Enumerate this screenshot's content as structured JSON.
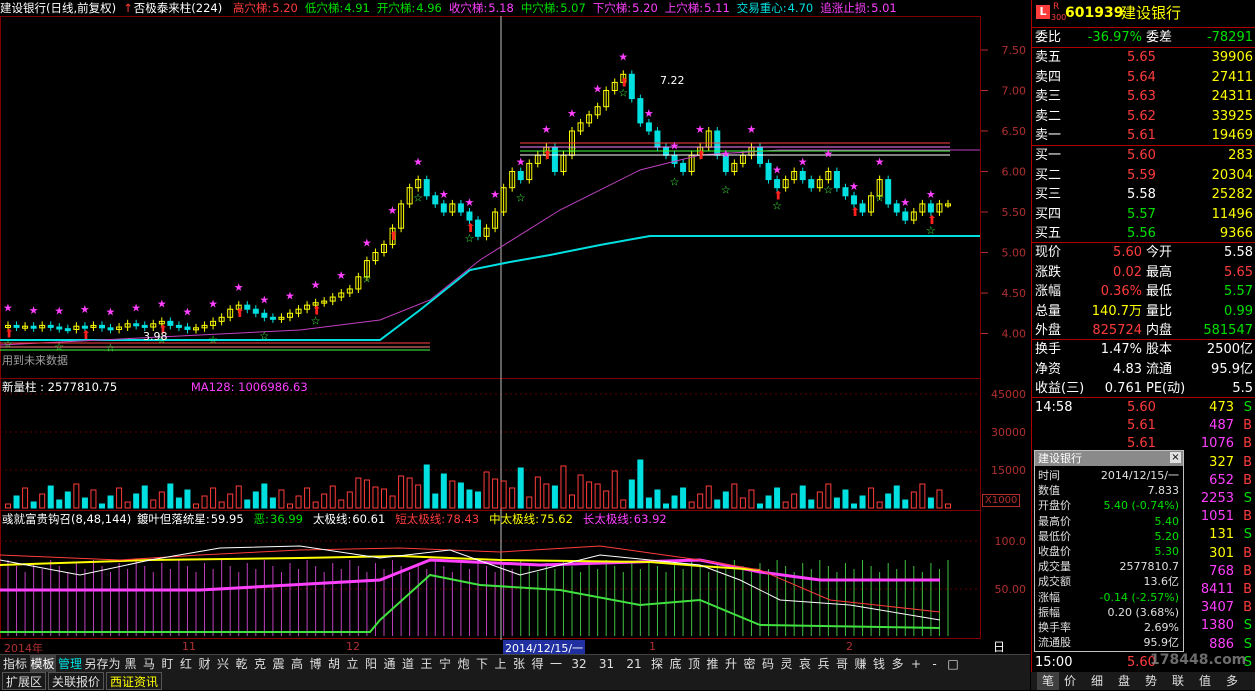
{
  "main_header": {
    "title": "建设银行(日线,前复权)",
    "indicator": "否极泰来柱(224)",
    "items": [
      {
        "label": "高穴梯:",
        "value": "5.20",
        "color": "#ff3c3c"
      },
      {
        "label": "低穴梯:",
        "value": "4.91",
        "color": "#00e000"
      },
      {
        "label": "开穴梯:",
        "value": "4.96",
        "color": "#00e000"
      },
      {
        "label": "收穴梯:",
        "value": "5.18",
        "color": "#ff40ff"
      },
      {
        "label": "中穴梯:",
        "value": "5.07",
        "color": "#00e000"
      },
      {
        "label": "下穴梯:",
        "value": "5.20",
        "color": "#ff40ff"
      },
      {
        "label": "上穴梯:",
        "value": "5.11",
        "color": "#ff40ff"
      },
      {
        "label": "交易重心:",
        "value": "4.70",
        "color": "#00e0e0"
      },
      {
        "label": "追涨止损:",
        "value": "5.01",
        "color": "#ff40ff"
      }
    ]
  },
  "price_axis": [
    "7.50",
    "7.00",
    "6.50",
    "6.00",
    "5.50",
    "5.00",
    "4.50",
    "4.00"
  ],
  "future_note": "用到未来数据",
  "chart_labels": {
    "high": "7.22",
    "low": "3.98"
  },
  "volume_header": {
    "label": "新量柱 : 2577810.75",
    "ma": "MA128: 1006986.63"
  },
  "volume_axis": [
    "45000",
    "30000",
    "15000"
  ],
  "volume_unit": "X1000",
  "ind2_header": {
    "name": "彧就富贵钩召(8,48,144)",
    "items": [
      {
        "label": "鍍叶但落统星:",
        "value": "59.95",
        "color": "#ffffff"
      },
      {
        "label": "恶:",
        "value": "36.99",
        "color": "#00e000"
      },
      {
        "label": "太极线:",
        "value": "60.61",
        "color": "#ffffff"
      },
      {
        "label": "短太极线:",
        "value": "78.43",
        "color": "#ff3c3c"
      },
      {
        "label": "中太极线:",
        "value": "75.62",
        "color": "#ffff00"
      },
      {
        "label": "长太极线:",
        "value": "63.92",
        "color": "#ff40ff"
      }
    ]
  },
  "ind2_axis": [
    "100.0",
    "50.00"
  ],
  "date_axis": {
    "left": "2014年",
    "m11": "11",
    "m12": "12",
    "cursor": "2014/12/15/一",
    "m1": "1",
    "m2": "2",
    "right": "日线"
  },
  "stock": {
    "code": "601939",
    "name": "建设银行",
    "badge_l": "L",
    "badge_r": "R",
    "badge_num": "300"
  },
  "commission": {
    "ratio_label": "委比",
    "ratio": "-36.97%",
    "diff_label": "委差",
    "diff": "-78291"
  },
  "asks": [
    {
      "label": "卖五",
      "price": "5.65",
      "vol": "39906"
    },
    {
      "label": "卖四",
      "price": "5.64",
      "vol": "27411"
    },
    {
      "label": "卖三",
      "price": "5.63",
      "vol": "24311"
    },
    {
      "label": "卖二",
      "price": "5.62",
      "vol": "33925"
    },
    {
      "label": "卖一",
      "price": "5.61",
      "vol": "19469"
    }
  ],
  "bids": [
    {
      "label": "买一",
      "price": "5.60",
      "vol": "283",
      "pcolor": "#ff3c3c"
    },
    {
      "label": "买二",
      "price": "5.59",
      "vol": "20304",
      "pcolor": "#ff3c3c"
    },
    {
      "label": "买三",
      "price": "5.58",
      "vol": "25282",
      "pcolor": "#ffffff"
    },
    {
      "label": "买四",
      "price": "5.57",
      "vol": "11496",
      "pcolor": "#00e000"
    },
    {
      "label": "买五",
      "price": "5.56",
      "vol": "9366",
      "pcolor": "#00e000"
    }
  ],
  "stats": [
    {
      "k1": "现价",
      "v1": "5.60",
      "c1": "#ff3c3c",
      "k2": "今开",
      "v2": "5.58",
      "c2": "#ffffff"
    },
    {
      "k1": "涨跌",
      "v1": "0.02",
      "c1": "#ff3c3c",
      "k2": "最高",
      "v2": "5.65",
      "c2": "#ff3c3c"
    },
    {
      "k1": "涨幅",
      "v1": "0.36%",
      "c1": "#ff3c3c",
      "k2": "最低",
      "v2": "5.57",
      "c2": "#00e000"
    },
    {
      "k1": "总量",
      "v1": "140.7万",
      "c1": "#ffff00",
      "k2": "量比",
      "v2": "0.99",
      "c2": "#00e000"
    },
    {
      "k1": "外盘",
      "v1": "825724",
      "c1": "#ff3c3c",
      "k2": "内盘",
      "v2": "581547",
      "c2": "#00e000"
    }
  ],
  "stats2": [
    {
      "k1": "换手",
      "v1": "1.47%",
      "k2": "股本",
      "v2": "2500亿"
    },
    {
      "k1": "净资",
      "v1": "4.83",
      "k2": "流通",
      "v2": "95.9亿"
    },
    {
      "k1": "收益(三)",
      "v1": "0.761",
      "k2": "PE(动)",
      "v2": "5.5"
    }
  ],
  "ticks": [
    {
      "time": "14:58",
      "price": "5.60",
      "vol": "473",
      "bs": "S",
      "pc": "#ff3c3c",
      "vc": "#ffff00",
      "bc": "#00e000"
    },
    {
      "time": "",
      "price": "5.61",
      "vol": "487",
      "bs": "B",
      "pc": "#ff3c3c",
      "vc": "#ff40ff",
      "bc": "#ff3c3c"
    },
    {
      "time": "",
      "price": "5.61",
      "vol": "1076",
      "bs": "B",
      "pc": "#ff3c3c",
      "vc": "#ff40ff",
      "bc": "#ff3c3c"
    },
    {
      "time": "",
      "price": "",
      "vol": "327",
      "bs": "B",
      "pc": "#ff3c3c",
      "vc": "#ffff00",
      "bc": "#ff3c3c"
    },
    {
      "time": "",
      "price": "",
      "vol": "652",
      "bs": "B",
      "pc": "#ff3c3c",
      "vc": "#ff40ff",
      "bc": "#ff3c3c"
    },
    {
      "time": "",
      "price": "",
      "vol": "2253",
      "bs": "S",
      "pc": "#ff3c3c",
      "vc": "#ff40ff",
      "bc": "#00e000"
    },
    {
      "time": "",
      "price": "",
      "vol": "1051",
      "bs": "B",
      "pc": "#ff3c3c",
      "vc": "#ff40ff",
      "bc": "#ff3c3c"
    },
    {
      "time": "",
      "price": "",
      "vol": "131",
      "bs": "S",
      "pc": "#ff3c3c",
      "vc": "#ffff00",
      "bc": "#00e000"
    },
    {
      "time": "",
      "price": "",
      "vol": "301",
      "bs": "B",
      "pc": "#ff3c3c",
      "vc": "#ffff00",
      "bc": "#ff3c3c"
    },
    {
      "time": "",
      "price": "",
      "vol": "768",
      "bs": "B",
      "pc": "#ff3c3c",
      "vc": "#ff40ff",
      "bc": "#ff3c3c"
    },
    {
      "time": "",
      "price": "",
      "vol": "8411",
      "bs": "B",
      "pc": "#ff3c3c",
      "vc": "#ff40ff",
      "bc": "#ff3c3c"
    },
    {
      "time": "",
      "price": "",
      "vol": "3407",
      "bs": "B",
      "pc": "#ff3c3c",
      "vc": "#ff40ff",
      "bc": "#ff3c3c"
    },
    {
      "time": "",
      "price": "",
      "vol": "1380",
      "bs": "S",
      "pc": "#ff3c3c",
      "vc": "#ff40ff",
      "bc": "#00e000"
    },
    {
      "time": "",
      "price": "",
      "vol": "886",
      "bs": "S",
      "pc": "#ff3c3c",
      "vc": "#ff40ff",
      "bc": "#00e000"
    },
    {
      "time": "15:00",
      "price": "5.60",
      "vol": "",
      "bs": "S",
      "pc": "#ff3c3c",
      "vc": "#ff40ff",
      "bc": "#00e000"
    }
  ],
  "popup": {
    "title": "建设银行",
    "rows": [
      {
        "k": "时间",
        "v": "2014/12/15/一",
        "c": "#e0e0e0"
      },
      {
        "k": "数值",
        "v": "7.833",
        "c": "#e0e0e0"
      },
      {
        "k": "开盘价",
        "v": "5.40 (-0.74%)",
        "c": "#00e000"
      },
      {
        "k": "最高价",
        "v": "5.40",
        "c": "#00e000"
      },
      {
        "k": "最低价",
        "v": "5.20",
        "c": "#00e000"
      },
      {
        "k": "收盘价",
        "v": "5.30",
        "c": "#00e000"
      },
      {
        "k": "成交量",
        "v": "2577810.7",
        "c": "#e0e0e0"
      },
      {
        "k": "成交额",
        "v": "13.6亿",
        "c": "#e0e0e0"
      },
      {
        "k": "涨幅",
        "v": "-0.14 (-2.57%)",
        "c": "#00e000"
      },
      {
        "k": "振幅",
        "v": "0.20 (3.68%)",
        "c": "#e0e0e0"
      },
      {
        "k": "换手率",
        "v": "2.69%",
        "c": "#e0e0e0"
      },
      {
        "k": "流通股",
        "v": "95.9亿",
        "c": "#e0e0e0"
      }
    ]
  },
  "tabs": [
    "指标",
    "模板",
    "管理",
    "另存为",
    "黑",
    "马",
    "盯",
    "红",
    "财",
    "兴",
    "乾",
    "克",
    "震",
    "高",
    "博",
    "胡",
    "立",
    "阳",
    "通",
    "道",
    "王",
    "宁",
    "炮",
    "下",
    "上",
    "张",
    "得",
    "一",
    "32",
    "31",
    "21",
    "探",
    "底",
    "顶",
    "推",
    "升",
    "密",
    "码",
    "灵",
    "哀",
    "兵",
    "哥",
    "赚",
    "钱",
    "多",
    "+",
    "-",
    "□"
  ],
  "tabs2": [
    "扩展区",
    "关联报价",
    "西证资讯"
  ],
  "right_bottom_tabs": [
    "笔",
    "价",
    "细",
    "盘",
    "势",
    "联",
    "值",
    "多"
  ],
  "watermark": "178448.com"
}
